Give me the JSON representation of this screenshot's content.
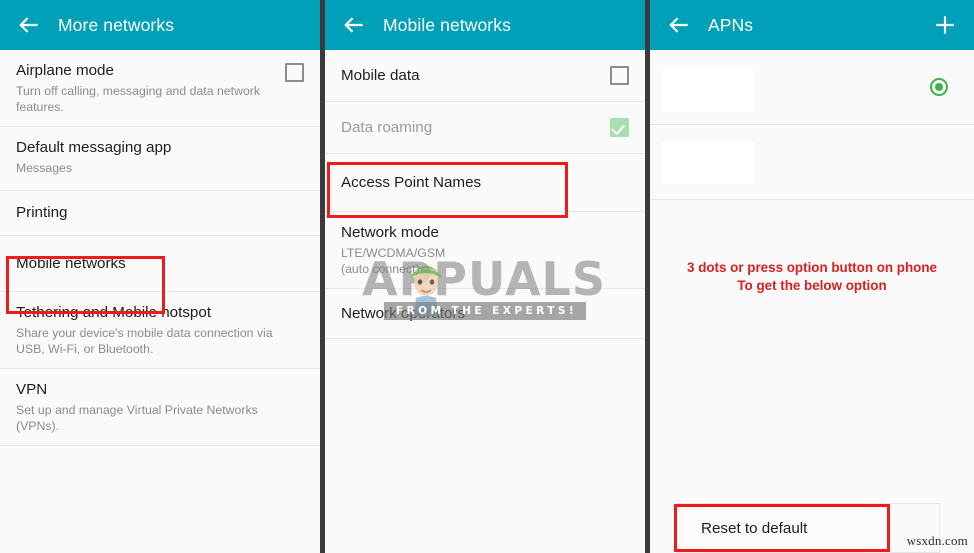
{
  "panels": [
    {
      "id": "more-networks",
      "appbar": {
        "title": "More networks",
        "back_icon": "back-arrow-icon"
      },
      "rows": [
        {
          "title": "Airplane mode",
          "subtitle": "Turn off calling, messaging and data network features.",
          "control": "checkbox-unchecked"
        },
        {
          "title": "Default messaging app",
          "subtitle": "Messages",
          "control": "none"
        },
        {
          "title": "Printing",
          "subtitle": "",
          "control": "none"
        },
        {
          "title": "Mobile networks",
          "subtitle": "",
          "control": "none"
        },
        {
          "title": "Tethering and Mobile hotspot",
          "subtitle": "Share your device's mobile data connection via USB, Wi-Fi, or Bluetooth.",
          "control": "none"
        },
        {
          "title": "VPN",
          "subtitle": "Set up and manage Virtual Private Networks (VPNs).",
          "control": "none"
        }
      ]
    },
    {
      "id": "mobile-networks",
      "appbar": {
        "title": "Mobile networks",
        "back_icon": "back-arrow-icon"
      },
      "rows": [
        {
          "title": "Mobile data",
          "subtitle": "",
          "control": "checkbox-unchecked"
        },
        {
          "title": "Data roaming",
          "subtitle": "",
          "control": "checkbox-checked-disabled",
          "dim": true
        },
        {
          "title": "Access Point Names",
          "subtitle": "",
          "control": "none"
        },
        {
          "title": "Network mode",
          "subtitle": "LTE/WCDMA/GSM\n(auto connect)",
          "control": "none"
        },
        {
          "title": "Network operators",
          "subtitle": "",
          "control": "none"
        }
      ]
    },
    {
      "id": "apns",
      "appbar": {
        "title": "APNs",
        "back_icon": "back-arrow-icon",
        "add_icon": "plus-icon"
      },
      "rows": [
        {
          "title": "",
          "subtitle": "",
          "control": "radio-selected",
          "redacted": true
        },
        {
          "title": "",
          "subtitle": "",
          "control": "none",
          "redacted": true
        }
      ],
      "menu": {
        "reset_label": "Reset to default"
      }
    }
  ],
  "annotations": {
    "apn_hint_line1": "3 dots or press option button on phone",
    "apn_hint_line2": "To get the below option",
    "highlight_color": "#ee1b1b"
  },
  "watermarks": {
    "brand": "APPUALS",
    "tagline": "FROM THE EXPERTS!",
    "site": "wsxdn.com"
  }
}
